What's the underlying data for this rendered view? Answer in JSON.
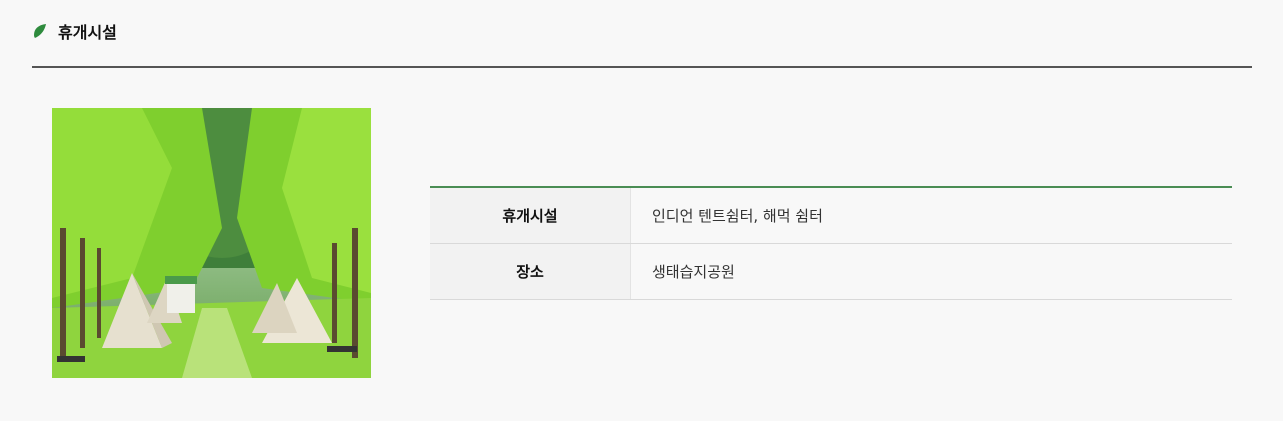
{
  "section": {
    "title": "휴개시설",
    "icon": "leaf-icon",
    "accent_color": "#2e8b3d"
  },
  "table": {
    "rows": [
      {
        "label": "휴개시설",
        "value": "인디언 텐트쉼터, 해먹 쉼터"
      },
      {
        "label": "장소",
        "value": "생태습지공원"
      }
    ]
  }
}
